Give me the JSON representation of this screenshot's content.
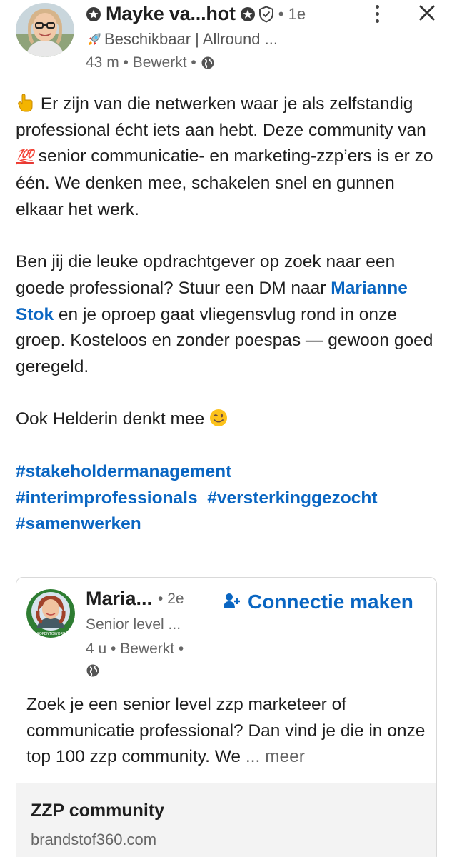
{
  "author": {
    "name": "Mayke va...hot",
    "degree": "• 1e",
    "headline": "Beschikbaar | Allround ...",
    "meta": "43 m • Bewerkt •"
  },
  "post": {
    "paragraph1": "Er zijn van die netwerken waar je als zelfstandig professional écht iets aan hebt. Deze community van",
    "paragraph1_emoji": "💯",
    "paragraph1_rest": "senior communicatie- en marketing-zzp’ers is er zo één. We denken mee, schakelen snel en gunnen elkaar het werk.",
    "paragraph2_start": "Ben jij die leuke opdrachtgever op zoek naar een goede professional? Stuur een DM naar",
    "mention": "Marianne Stok",
    "paragraph2_end": "en je oproep gaat vliegensvlug rond in onze groep. Kosteloos en zonder poespas — gewoon goed geregeld.",
    "paragraph3": "Ook Helderin denkt mee",
    "hashtags": [
      "#stakeholdermanagement",
      "#interimprofessionals",
      "#versterkinggezocht",
      "#samenwerken"
    ]
  },
  "shared": {
    "name": "Maria...",
    "degree": "• 2e",
    "connect_label": "Connectie maken",
    "headline": "Senior level ...",
    "meta": "4 u • Bewerkt •",
    "avatar_frame_text": "#OPENTOWORK",
    "text": "Zoek je een senior level zzp marketeer of communicatie professional? Dan vind je die in onze top 100 zzp community. We",
    "more_label": "... meer",
    "link_title": "ZZP community",
    "link_domain": "brandstof360.com"
  },
  "colors": {
    "link": "#0a66c2",
    "text": "#1f1f1f",
    "muted": "#666666",
    "open_to_work": "#2e7d32"
  }
}
